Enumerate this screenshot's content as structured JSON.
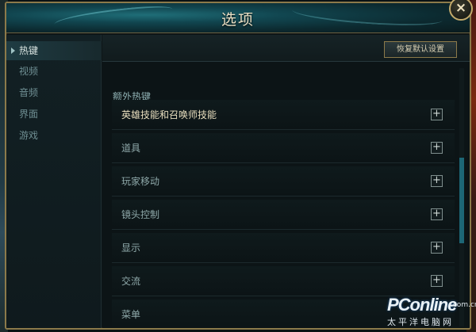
{
  "window": {
    "title": "选项"
  },
  "close": {
    "glyph": "×"
  },
  "sidebar": {
    "items": [
      {
        "label": "热键",
        "active": true
      },
      {
        "label": "视频",
        "active": false
      },
      {
        "label": "音频",
        "active": false
      },
      {
        "label": "界面",
        "active": false
      },
      {
        "label": "游戏",
        "active": false
      }
    ]
  },
  "toolbar": {
    "reset_label": "恢复默认设置"
  },
  "hotkeys": {
    "section_label": "额外热键",
    "groups": [
      {
        "label": "英雄技能和召唤师技能"
      },
      {
        "label": "道具"
      },
      {
        "label": "玩家移动"
      },
      {
        "label": "镜头控制"
      },
      {
        "label": "显示"
      },
      {
        "label": "交流"
      },
      {
        "label": "菜单"
      }
    ],
    "expand_glyph": "+"
  },
  "watermark": {
    "brand": "PConline",
    "domain": ".com.cn",
    "sub": "太平洋电脑网"
  },
  "colors": {
    "accent_gold": "#8c7a4a",
    "scroll_thumb": "#1d6675",
    "active_text": "#d9e4e1"
  }
}
